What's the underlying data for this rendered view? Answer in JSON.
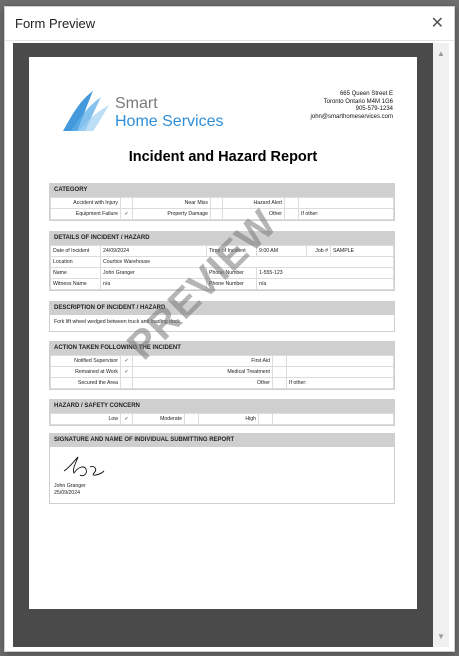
{
  "dialog": {
    "title": "Form Preview"
  },
  "company": {
    "name_line1": "Smart",
    "name_line2": "Home Services",
    "address": [
      "665 Queen Street E",
      "Toronto Ontario M4M 1G6",
      "905-579-1234",
      "john@smarthomeservices.com"
    ]
  },
  "report": {
    "title": "Incident and Hazard Report",
    "watermark": "PREVIEW",
    "category": {
      "header": "CATEGORY",
      "rows": [
        [
          {
            "label": "Accident with Injury",
            "value": ""
          },
          {
            "label": "Near Miss",
            "value": ""
          },
          {
            "label": "Hazard Alert",
            "value": ""
          }
        ],
        [
          {
            "label": "Equipment Failure",
            "value": "✓"
          },
          {
            "label": "Property Damage",
            "value": ""
          },
          {
            "label": "Other",
            "value": ""
          }
        ]
      ],
      "if_other": "If other:"
    },
    "details": {
      "header": "DETAILS OF INCIDENT / HAZARD",
      "date_label": "Date of Incident",
      "date": "24/09/2024",
      "time_label": "Time of Incident",
      "time": "9:00 AM",
      "job_label": "Job #",
      "job": "SAMPLE",
      "location_label": "Location",
      "location": "Courtice Warehouse",
      "name_label": "Name",
      "name": "John Granger",
      "phone_label": "Phone Number",
      "phone": "1-555-123",
      "witness_label": "Witness Name",
      "witness": "n/a",
      "witness_phone_label": "Phone Number",
      "witness_phone": "n/a"
    },
    "description": {
      "header": "DESCRIPTION OF INCIDENT / HAZARD",
      "text": "Fork lift wheel wedged between truck and loading dock"
    },
    "action": {
      "header": "ACTION TAKEN FOLLOWING THE INCIDENT",
      "rows": [
        [
          {
            "label": "Notified Supervisor",
            "value": "✓"
          },
          {
            "label": "First Aid",
            "value": ""
          }
        ],
        [
          {
            "label": "Remained at Work",
            "value": "✓"
          },
          {
            "label": "Medical Treatment",
            "value": ""
          }
        ],
        [
          {
            "label": "Secured the Area",
            "value": ""
          },
          {
            "label": "Other",
            "value": ""
          }
        ]
      ],
      "other_label": "If other:"
    },
    "hazard": {
      "header": "HAZARD / SAFETY CONCERN",
      "low_label": "Low",
      "low": "✓",
      "moderate_label": "Moderate",
      "moderate": "",
      "high_label": "High",
      "high": ""
    },
    "signature": {
      "header": "SIGNATURE AND NAME OF INDIVIDUAL SUBMITTING REPORT",
      "name": "John Granger",
      "date": "25/09/2024"
    }
  },
  "colors": {
    "brand_blue": "#2f8ed8",
    "brand_grey": "#7a7a7a",
    "section_header": "#cfcfcf"
  }
}
